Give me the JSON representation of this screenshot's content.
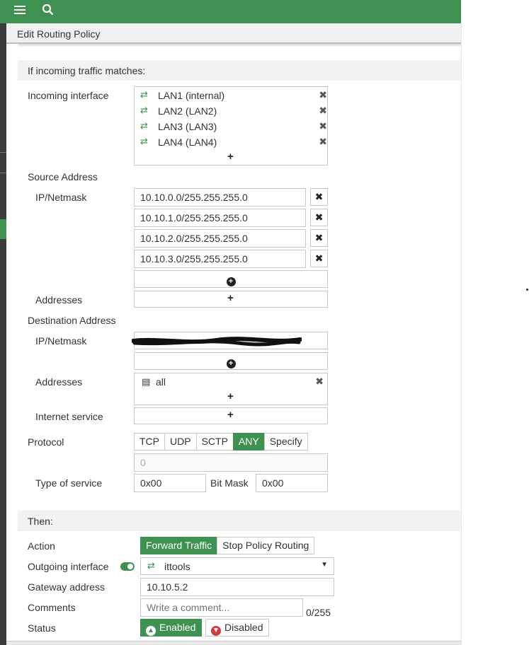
{
  "topbar": {
    "menu_icon": "≡",
    "search_icon": "search"
  },
  "title": "Edit Routing Policy",
  "match_section": "If incoming traffic matches:",
  "incoming_interface": {
    "label": "Incoming interface",
    "items": [
      "LAN1 (internal)",
      "LAN2 (LAN2)",
      "LAN3 (LAN3)",
      "LAN4 (LAN4)"
    ],
    "add": "+"
  },
  "source": {
    "label": "Source Address",
    "ip_label": "IP/Netmask",
    "ips": [
      "10.10.0.0/255.255.255.0",
      "10.10.1.0/255.255.255.0",
      "10.10.2.0/255.255.255.0",
      "10.10.3.0/255.255.255.0"
    ],
    "addresses_label": "Addresses",
    "addresses_add": "+"
  },
  "destination": {
    "label": "Destination Address",
    "ip_label": "IP/Netmask",
    "addresses_label": "Addresses",
    "addresses": [
      "all"
    ],
    "addresses_add": "+",
    "internet_service_label": "Internet service",
    "internet_service_add": "+"
  },
  "protocol": {
    "label": "Protocol",
    "options": [
      "TCP",
      "UDP",
      "SCTP",
      "ANY",
      "Specify"
    ],
    "selected": "ANY",
    "number_value": "0"
  },
  "tos": {
    "label": "Type of service",
    "value": "0x00",
    "bitmask_label": "Bit Mask",
    "bitmask_value": "0x00"
  },
  "then_section": "Then:",
  "action": {
    "label": "Action",
    "options": [
      "Forward Traffic",
      "Stop Policy Routing"
    ],
    "selected": "Forward Traffic"
  },
  "outgoing": {
    "label": "Outgoing interface",
    "value": "ittools"
  },
  "gateway": {
    "label": "Gateway address",
    "value": "10.10.5.2"
  },
  "comments": {
    "label": "Comments",
    "placeholder": "Write a comment...",
    "counter": "0/255"
  },
  "status": {
    "label": "Status",
    "enabled": "Enabled",
    "disabled": "Disabled",
    "selected": "Enabled"
  },
  "colors": {
    "accent": "#3f9152",
    "disabled_icon": "#d23c3c"
  }
}
